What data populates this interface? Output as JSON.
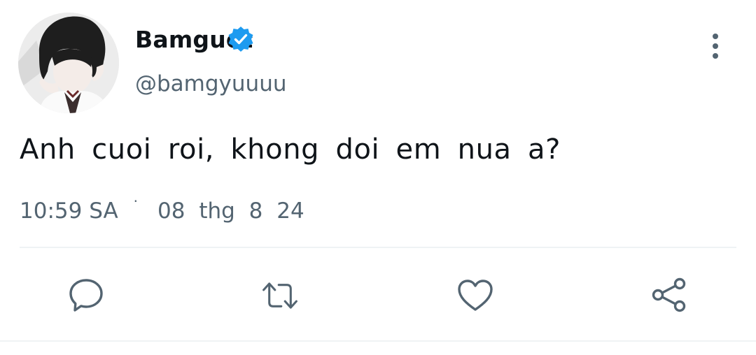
{
  "tweet": {
    "author": {
      "display_name": "Bamguet",
      "handle": "@bamgyuuuu",
      "verified": true,
      "verified_color": "#1d9bf0"
    },
    "text": "Anh cuoi roi, khong doi em nua a?",
    "time": "10:59 SA",
    "separator": "·",
    "date": "08 thg 8 24"
  },
  "actions": [
    {
      "icon": "reply-icon"
    },
    {
      "icon": "retweet-icon"
    },
    {
      "icon": "like-icon"
    },
    {
      "icon": "share-icon"
    }
  ],
  "colors": {
    "text_primary": "#0f1419",
    "text_secondary": "#536471",
    "divider": "#eff3f4"
  }
}
